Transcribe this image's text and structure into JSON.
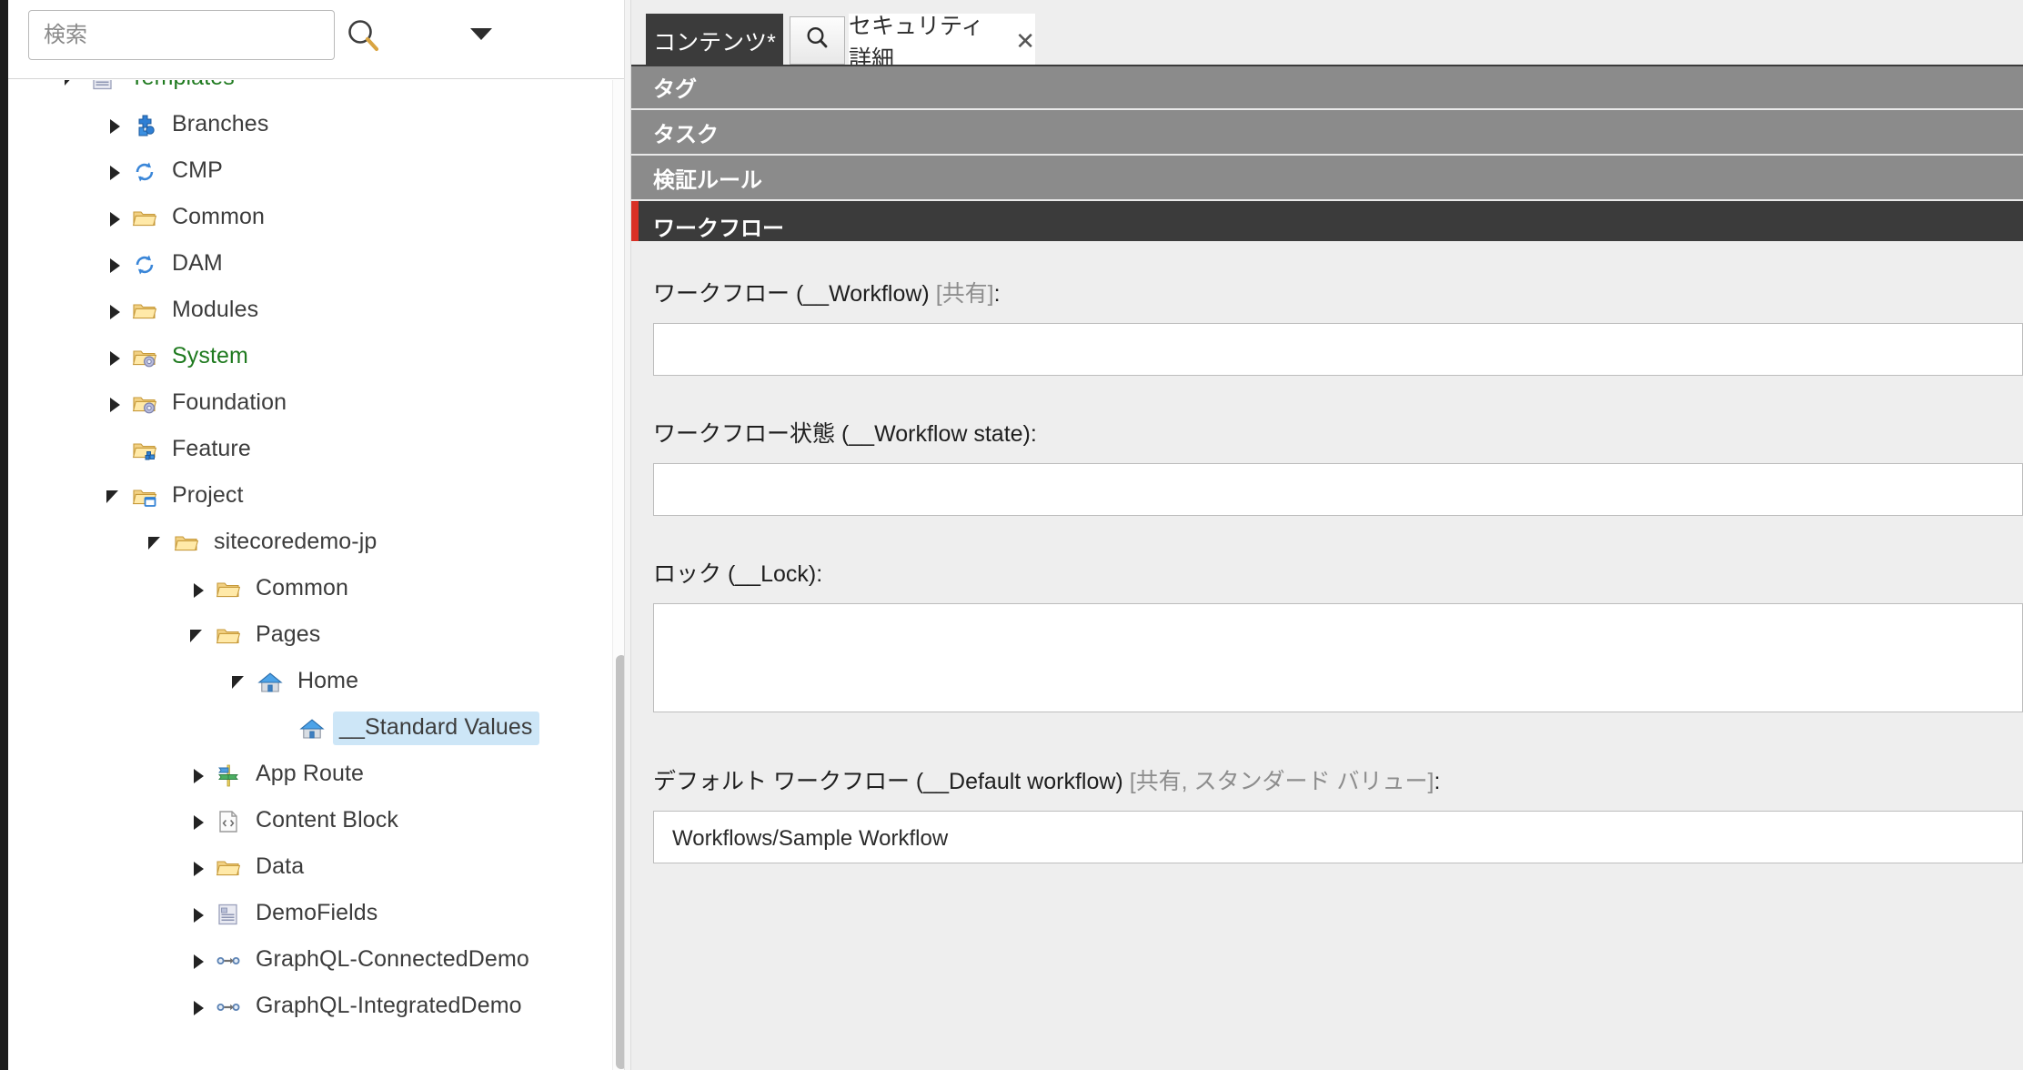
{
  "search": {
    "placeholder": "検索",
    "value": "",
    "search_icon": "magnifier-icon",
    "dropdown_icon": "chevron-down-icon"
  },
  "tree": {
    "items": [
      {
        "label": "Templates",
        "icon": "template-icon",
        "depth": 1,
        "state": "expanded",
        "color": "green",
        "selected": false
      },
      {
        "label": "Branches",
        "icon": "branch-icon",
        "depth": 2,
        "state": "collapsed",
        "color": "default",
        "selected": false
      },
      {
        "label": "CMP",
        "icon": "sync-icon",
        "depth": 2,
        "state": "collapsed",
        "color": "default",
        "selected": false
      },
      {
        "label": "Common",
        "icon": "folder-icon",
        "depth": 2,
        "state": "collapsed",
        "color": "default",
        "selected": false
      },
      {
        "label": "DAM",
        "icon": "sync-icon",
        "depth": 2,
        "state": "collapsed",
        "color": "default",
        "selected": false
      },
      {
        "label": "Modules",
        "icon": "folder-icon",
        "depth": 2,
        "state": "collapsed",
        "color": "default",
        "selected": false
      },
      {
        "label": "System",
        "icon": "folder-gear-icon",
        "depth": 2,
        "state": "collapsed",
        "color": "green",
        "selected": false
      },
      {
        "label": "Foundation",
        "icon": "folder-gear-icon",
        "depth": 2,
        "state": "collapsed",
        "color": "default",
        "selected": false
      },
      {
        "label": "Feature",
        "icon": "folder-blue-icon",
        "depth": 2,
        "state": "leaf",
        "color": "default",
        "selected": false
      },
      {
        "label": "Project",
        "icon": "folder-window-icon",
        "depth": 2,
        "state": "expanded",
        "color": "default",
        "selected": false
      },
      {
        "label": "sitecoredemo-jp",
        "icon": "folder-icon",
        "depth": 3,
        "state": "expanded",
        "color": "default",
        "selected": false
      },
      {
        "label": "Common",
        "icon": "folder-icon",
        "depth": 4,
        "state": "collapsed",
        "color": "default",
        "selected": false
      },
      {
        "label": "Pages",
        "icon": "folder-icon",
        "depth": 4,
        "state": "expanded",
        "color": "default",
        "selected": false
      },
      {
        "label": "Home",
        "icon": "home-icon",
        "depth": 5,
        "state": "expanded",
        "color": "default",
        "selected": false
      },
      {
        "label": "__Standard Values",
        "icon": "home-icon",
        "depth": 6,
        "state": "leaf",
        "color": "default",
        "selected": true
      },
      {
        "label": "App Route",
        "icon": "signpost-icon",
        "depth": 4,
        "state": "collapsed",
        "color": "default",
        "selected": false
      },
      {
        "label": "Content Block",
        "icon": "code-doc-icon",
        "depth": 4,
        "state": "collapsed",
        "color": "default",
        "selected": false
      },
      {
        "label": "Data",
        "icon": "folder-icon",
        "depth": 4,
        "state": "collapsed",
        "color": "default",
        "selected": false
      },
      {
        "label": "DemoFields",
        "icon": "template-icon",
        "depth": 4,
        "state": "collapsed",
        "color": "default",
        "selected": false
      },
      {
        "label": "GraphQL-ConnectedDemo",
        "icon": "graphql-icon",
        "depth": 4,
        "state": "collapsed",
        "color": "default",
        "selected": false
      },
      {
        "label": "GraphQL-IntegratedDemo",
        "icon": "graphql-icon",
        "depth": 4,
        "state": "collapsed",
        "color": "default",
        "selected": false
      }
    ]
  },
  "tabs": {
    "content_tab": "コンテンツ*",
    "search_button_icon": "magnifier-icon",
    "security_tab": "セキュリティ詳細",
    "security_tab_close_icon": "close-icon"
  },
  "sections": [
    {
      "title": "タグ",
      "active": false
    },
    {
      "title": "タスク",
      "active": false
    },
    {
      "title": "検証ルール",
      "active": false
    },
    {
      "title": "ワークフロー",
      "active": true
    }
  ],
  "fields": {
    "workflow": {
      "label_main": "ワークフロー (__Workflow) ",
      "label_meta": "[共有]",
      "label_colon": ":",
      "value": ""
    },
    "workflow_state": {
      "label_main": "ワークフロー状態 (__Workflow state)",
      "label_meta": "",
      "label_colon": ":",
      "value": ""
    },
    "lock": {
      "label_main": "ロック (__Lock)",
      "label_meta": "",
      "label_colon": ":",
      "value": ""
    },
    "default_workflow": {
      "label_main": "デフォルト ワークフロー (__Default workflow) ",
      "label_meta": "[共有, スタンダード バリュー]",
      "label_colon": ":",
      "value": "Workflows/Sample Workflow"
    }
  },
  "colors": {
    "accent_red": "#d93025",
    "section_gray": "#8b8b8b",
    "section_active": "#3b3b3b",
    "selection_blue": "#cde6f7",
    "tree_green": "#1f7a1f",
    "panel_bg": "#eeeeee"
  }
}
